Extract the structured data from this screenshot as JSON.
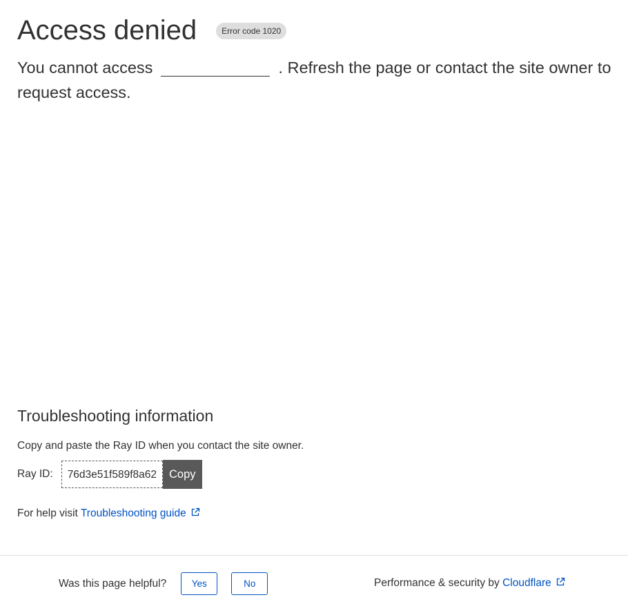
{
  "header": {
    "title": "Access denied",
    "error_badge": "Error code 1020"
  },
  "message": {
    "prefix": "You cannot access",
    "suffix": ". Refresh the page or contact the site owner to request access."
  },
  "troubleshooting": {
    "title": "Troubleshooting information",
    "instructions": "Copy and paste the Ray ID when you contact the site owner.",
    "ray_label": "Ray ID:",
    "ray_id": "76d3e51f589f8a62",
    "copy_label": "Copy",
    "help_prefix": "For help visit",
    "help_link": "Troubleshooting guide"
  },
  "footer": {
    "question": "Was this page helpful?",
    "yes_label": "Yes",
    "no_label": "No",
    "perf_prefix": "Performance & security by",
    "perf_link": "Cloudflare"
  },
  "colors": {
    "text": "#313131",
    "link": "#0051c3",
    "badge_bg": "#dedede",
    "copy_bg": "#595959"
  }
}
